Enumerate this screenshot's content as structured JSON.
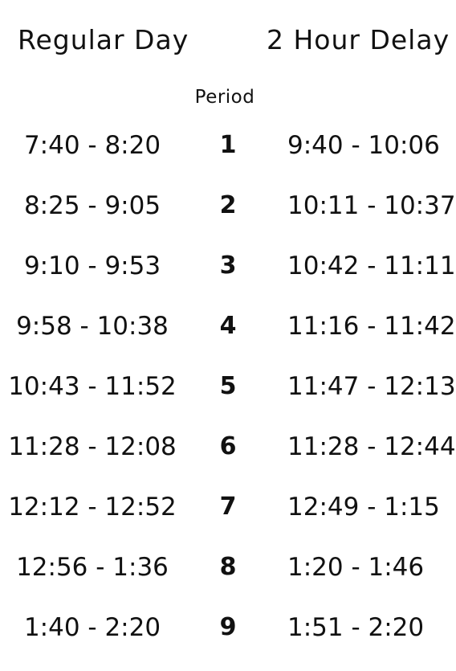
{
  "headers": {
    "regular_day": "Regular Day",
    "two_hour_delay": "2 Hour Delay",
    "period": "Period"
  },
  "schedule": [
    {
      "regular": "7:40 - 8:20",
      "period": "1",
      "delay": "9:40 - 10:06"
    },
    {
      "regular": "8:25 - 9:05",
      "period": "2",
      "delay": "10:11 - 10:37"
    },
    {
      "regular": "9:10 - 9:53",
      "period": "3",
      "delay": "10:42 - 11:11"
    },
    {
      "regular": "9:58 - 10:38",
      "period": "4",
      "delay": "11:16 - 11:42"
    },
    {
      "regular": "10:43 - 11:52",
      "period": "5",
      "delay": "11:47 - 12:13"
    },
    {
      "regular": "11:28 - 12:08",
      "period": "6",
      "delay": "11:28 - 12:44"
    },
    {
      "regular": "12:12 - 12:52",
      "period": "7",
      "delay": "12:49 - 1:15"
    },
    {
      "regular": "12:56 - 1:36",
      "period": "8",
      "delay": "1:20 - 1:46"
    },
    {
      "regular": "1:40 - 2:20",
      "period": "9",
      "delay": "1:51 - 2:20"
    }
  ]
}
